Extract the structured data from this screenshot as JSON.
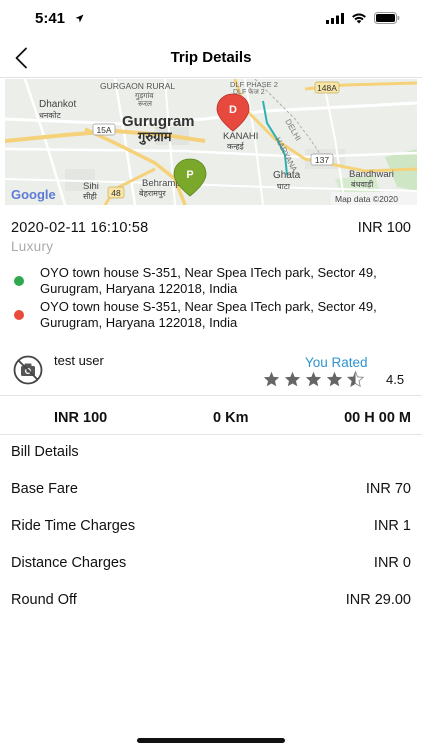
{
  "status_bar": {
    "time": "5:41"
  },
  "nav": {
    "title": "Trip Details"
  },
  "map": {
    "labels": {
      "gurgaon_rural_en": "GURGAON RURAL",
      "gurgaon_rural_hi": "गुड़गांव",
      "gurgaon_rural_hi2": "रूरल",
      "dlf2_en": "DLF PHASE 2",
      "dlf2_hi": "DLF फेज 2",
      "highway": "148A",
      "dhankot_en": "Dhankot",
      "dhankot_hi": "धनकोट",
      "gurugram_en": "Gurugram",
      "gurugram_hi": "गुरुग्राम",
      "road_15a": "15A",
      "delhi": "DELHI",
      "haryana": "HARYANA",
      "kanahi_en": "KANAHI",
      "kanahi_hi": "कन्हई",
      "road_137": "137",
      "ghata_en": "Ghata",
      "ghata_hi": "घाटा",
      "bandhwari_en": "Bandhwari",
      "bandhwari_hi": "बंधवाड़ी",
      "sihi_en": "Sihi",
      "sihi_hi": "सीही",
      "road_48": "48",
      "behrampur_en": "Behrampur",
      "behrampur_hi": "बेहरामपुर",
      "google": "Google",
      "copyright": "Map data ©2020",
      "drop_marker": "D",
      "pickup_marker": "P"
    },
    "colors": {
      "drop": "#e8493f",
      "pickup": "#7aa82a"
    }
  },
  "trip": {
    "datetime": "2020-02-11 16:10:58",
    "fare": "INR 100",
    "vehicle_type": "Luxury",
    "pickup_address": "OYO town house S-351, Near Spea ITech park, Sector 49, Gurugram, Haryana 122018, India",
    "drop_address": "OYO town house S-351, Near Spea ITech park, Sector 49, Gurugram, Haryana 122018, India",
    "pickup_color": "#2fa84f",
    "drop_color": "#e84a3c"
  },
  "driver": {
    "name": "test user",
    "rated_label": "You Rated",
    "rating": 4.5,
    "rating_text": "4.5",
    "avatar_icon": "no-photo-icon"
  },
  "summary": {
    "total": "INR 100",
    "distance": "0 Km",
    "duration": "00 H 00 M"
  },
  "bill": {
    "heading": "Bill Details",
    "items": [
      {
        "label": "Base Fare",
        "value": "INR 70"
      },
      {
        "label": "Ride Time Charges",
        "value": "INR 1"
      },
      {
        "label": "Distance Charges",
        "value": "INR 0"
      },
      {
        "label": "Round Off",
        "value": "INR 29.00"
      }
    ]
  }
}
